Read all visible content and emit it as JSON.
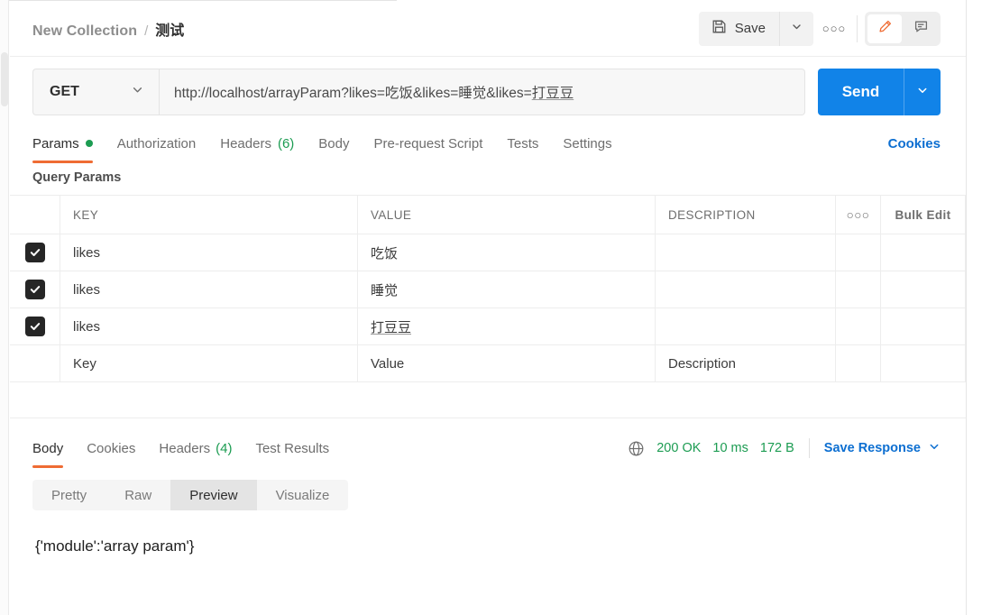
{
  "header": {
    "breadcrumb": {
      "collection": "New Collection",
      "separator": "/",
      "current": "测试"
    },
    "save_label": "Save",
    "save_icon": "floppy-disk-icon",
    "save_caret_icon": "chevron-down-icon",
    "more_label": "○○○",
    "edit_icon": "pencil-icon",
    "comment_icon": "comment-icon"
  },
  "request": {
    "method": "GET",
    "method_caret_icon": "chevron-down-icon",
    "url_prefix": "http://localhost/arrayParam?likes=吃饭&likes=睡觉&likes=",
    "url_suffix": "打豆豆",
    "url_full": "http://localhost/arrayParam?likes=吃饭&likes=睡觉&likes=打豆豆",
    "send_label": "Send",
    "send_caret_icon": "chevron-down-icon",
    "send_color": "#1183e8",
    "tabs": [
      {
        "label": "Params",
        "active": true,
        "dot": true
      },
      {
        "label": "Authorization",
        "active": false
      },
      {
        "label": "Headers",
        "count": "(6)",
        "active": false
      },
      {
        "label": "Body",
        "active": false
      },
      {
        "label": "Pre-request Script",
        "active": false
      },
      {
        "label": "Tests",
        "active": false
      },
      {
        "label": "Settings",
        "active": false
      }
    ],
    "cookies_link": "Cookies",
    "active_tab_accent": "#ef6c34"
  },
  "query_params": {
    "title": "Query Params",
    "columns": {
      "key": "KEY",
      "value": "VALUE",
      "description": "DESCRIPTION",
      "dots": "○○○",
      "bulk_edit": "Bulk Edit"
    },
    "rows": [
      {
        "checked": true,
        "key": "likes",
        "value": "吃饭",
        "description": ""
      },
      {
        "checked": true,
        "key": "likes",
        "value": "睡觉",
        "description": ""
      },
      {
        "checked": true,
        "key": "likes",
        "value": "打豆豆",
        "description": ""
      }
    ],
    "placeholders": {
      "key": "Key",
      "value": "Value",
      "description": "Description"
    }
  },
  "response": {
    "tabs": [
      {
        "label": "Body",
        "active": true
      },
      {
        "label": "Cookies",
        "active": false
      },
      {
        "label": "Headers",
        "count": "(4)",
        "active": false
      },
      {
        "label": "Test Results",
        "active": false
      }
    ],
    "globe_icon": "globe-icon",
    "status": "200 OK",
    "time": "10 ms",
    "size": "172 B",
    "status_color": "#1c9c52",
    "save_response_label": "Save Response",
    "save_response_caret_icon": "chevron-down-icon",
    "view_modes": [
      {
        "label": "Pretty",
        "active": false
      },
      {
        "label": "Raw",
        "active": false
      },
      {
        "label": "Preview",
        "active": true
      },
      {
        "label": "Visualize",
        "active": false
      }
    ],
    "body_text": "{'module':'array param'}"
  }
}
